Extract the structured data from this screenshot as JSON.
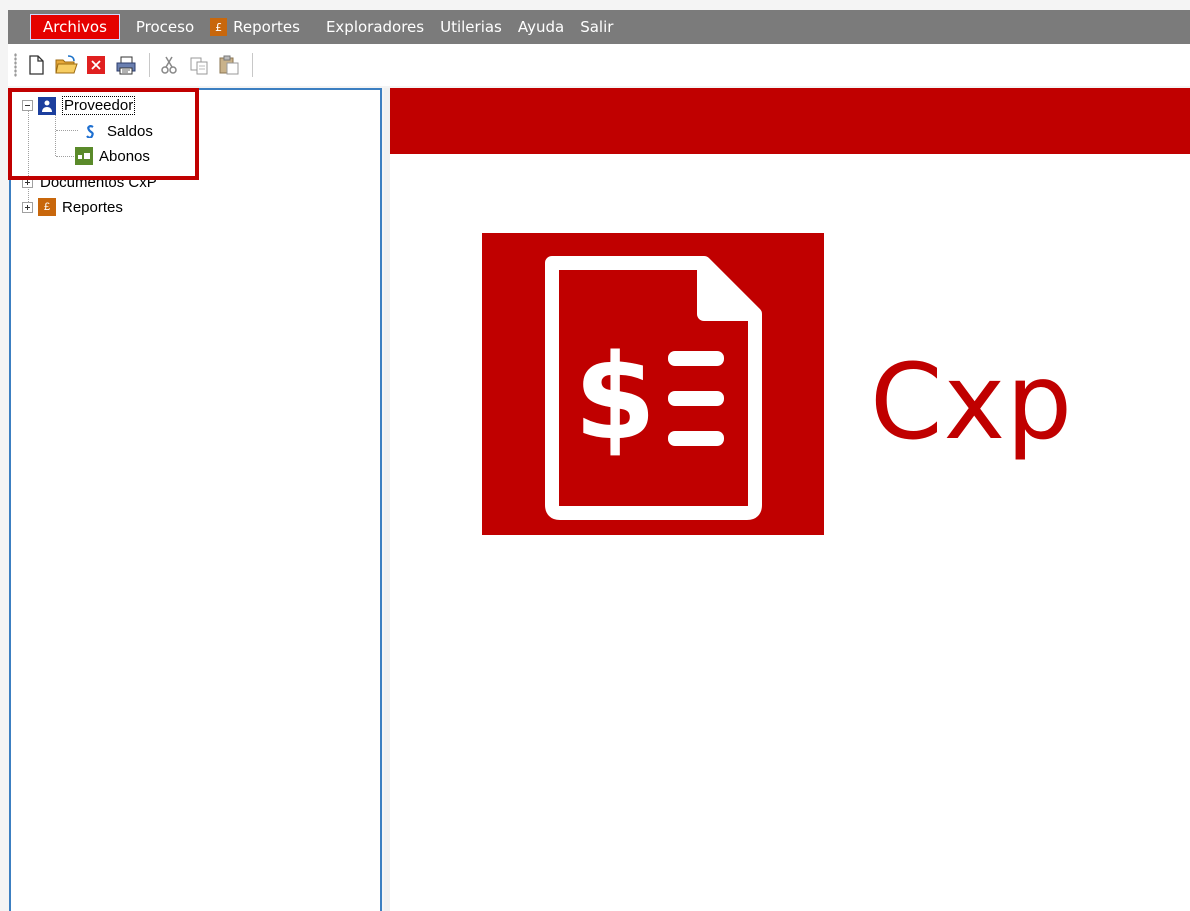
{
  "menubar": {
    "items": [
      {
        "label": "Archivos",
        "active": true
      },
      {
        "label": "Proceso"
      },
      {
        "label": "Reportes",
        "icon": "reports-icon"
      },
      {
        "label": "Exploradores"
      },
      {
        "label": "Utilerias"
      },
      {
        "label": "Ayuda"
      },
      {
        "label": "Salir"
      }
    ]
  },
  "toolbar": {
    "buttons": [
      "new-document-icon",
      "open-folder-icon",
      "delete-icon",
      "print-icon",
      "cut-icon",
      "copy-icon",
      "paste-icon"
    ]
  },
  "tree": {
    "nodes": [
      {
        "label": "Proveedor",
        "expanded": true,
        "icon": "supplier-icon",
        "children": [
          {
            "label": "Saldos",
            "icon": "balance-icon"
          },
          {
            "label": "Abonos",
            "icon": "payments-icon"
          }
        ]
      },
      {
        "label": "Documentos CxP",
        "expanded": false
      },
      {
        "label": "Reportes",
        "expanded": false,
        "icon": "reports-icon"
      }
    ]
  },
  "main": {
    "logo_text": "Cxp",
    "logo_icon": "invoice-dollar-icon"
  },
  "colors": {
    "brand_red": "#c00000",
    "menubar_gray": "#7b7b7b",
    "active_menu": "#e50000",
    "tree_border": "#3c7fc1"
  }
}
